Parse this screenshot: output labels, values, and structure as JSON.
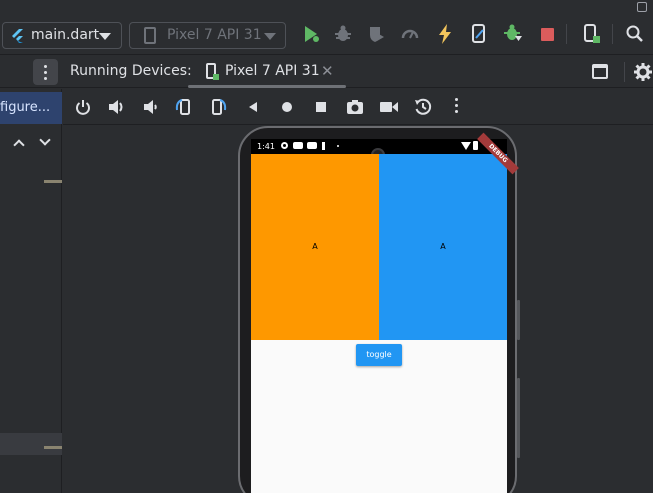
{
  "toolbar": {
    "run_config_label": "main.dart",
    "device_selector_label": "Pixel 7 API 31"
  },
  "tabs": {
    "running_devices_label": "Running Devices:",
    "device_tab_label": "Pixel 7 API 31",
    "close_symbol": "✕"
  },
  "left_panel": {
    "configure_label": "figure..."
  },
  "emulator": {
    "status_time": "1:41",
    "debug_banner": "DEBUG",
    "left_box_text": "A",
    "right_box_text": "A",
    "toggle_label": "toggle"
  },
  "colors": {
    "orange_box": "#fe9800",
    "blue_box": "#2196f3",
    "run_green": "#5fb865",
    "stop_red": "#db5c5c"
  }
}
